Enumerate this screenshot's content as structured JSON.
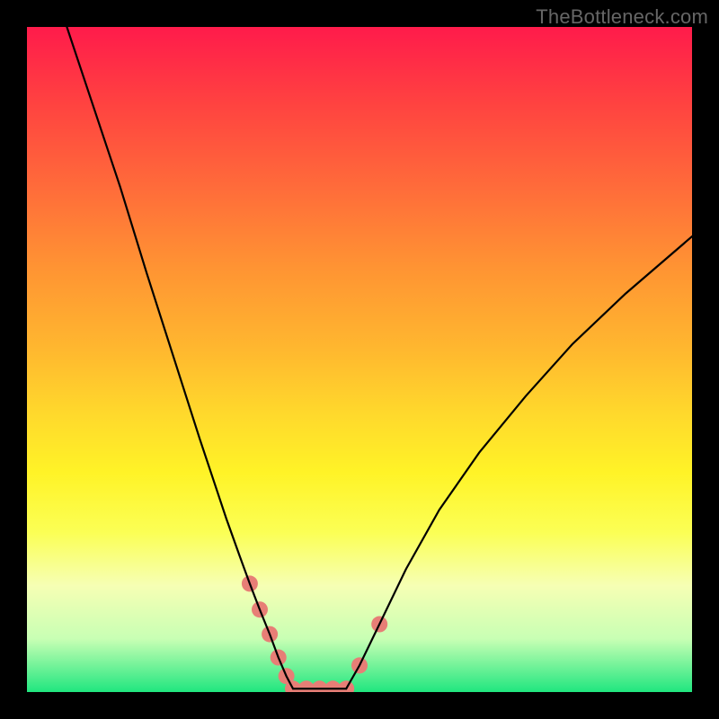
{
  "watermark": "TheBottleneck.com",
  "chart_data": {
    "type": "line",
    "title": "",
    "xlabel": "",
    "ylabel": "",
    "xlim": [
      0,
      100
    ],
    "ylim": [
      0,
      100
    ],
    "series": [
      {
        "name": "left-curve",
        "x": [
          6,
          10,
          14,
          18,
          22,
          26,
          28,
          30,
          32,
          33.5,
          35,
          36.5,
          37.8,
          39,
          40
        ],
        "y": [
          100,
          88,
          76,
          63,
          50.5,
          38,
          32,
          26,
          20.4,
          16.3,
          12.4,
          8.7,
          5.2,
          2.4,
          0.5
        ]
      },
      {
        "name": "flat-min",
        "x": [
          40,
          42,
          44,
          46,
          48
        ],
        "y": [
          0.5,
          0.5,
          0.5,
          0.5,
          0.5
        ]
      },
      {
        "name": "right-curve",
        "x": [
          48,
          50,
          53,
          57,
          62,
          68,
          75,
          82,
          90,
          100
        ],
        "y": [
          0.5,
          4.0,
          10.2,
          18.5,
          27.4,
          36.0,
          44.5,
          52.3,
          59.9,
          68.5
        ]
      }
    ],
    "markers": {
      "name": "highlight-dots",
      "x": [
        33.5,
        35.0,
        36.5,
        37.8,
        39.0,
        40.0,
        42.0,
        44.0,
        46.0,
        48.0,
        50.0,
        53.0
      ],
      "y": [
        16.3,
        12.4,
        8.7,
        5.2,
        2.4,
        0.5,
        0.5,
        0.5,
        0.5,
        0.5,
        4.0,
        10.2
      ],
      "radius": 9,
      "color": "#e77e76"
    },
    "gradient_background": true
  }
}
